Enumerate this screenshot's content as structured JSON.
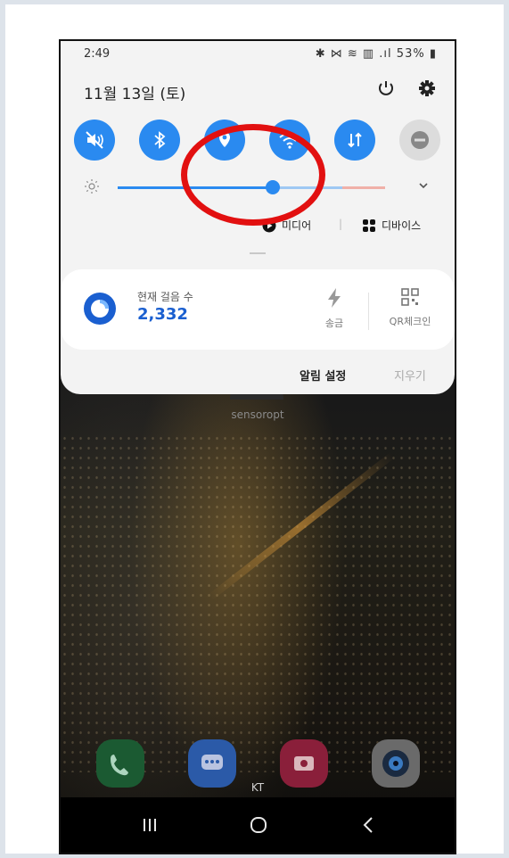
{
  "status_bar": {
    "time": "2:49",
    "icons": "✱ ⋈ ≋ ▥ .ıl",
    "battery": "53%"
  },
  "shade": {
    "date": "11월 13일 (토)",
    "power_icon": "power-icon",
    "settings_icon": "gear-icon",
    "quick_tiles": [
      {
        "name": "mute-icon",
        "state": "on"
      },
      {
        "name": "bluetooth-icon",
        "state": "on"
      },
      {
        "name": "location-icon",
        "state": "on"
      },
      {
        "name": "wifi-icon",
        "state": "on"
      },
      {
        "name": "data-transfer-icon",
        "state": "on"
      },
      {
        "name": "do-not-disturb-icon",
        "state": "off"
      }
    ],
    "brightness_level": 0.58,
    "media_label": "미디어",
    "devices_label": "디바이스"
  },
  "notification_card": {
    "steps_label": "현재 걸음 수",
    "steps_value": "2,332",
    "send_label": "송금",
    "qr_label": "QR체크인"
  },
  "footer": {
    "notification_settings": "알림 설정",
    "clear": "지우기"
  },
  "home": {
    "profile_label": "sensoropt",
    "carrier": "KT"
  },
  "colors": {
    "accent": "#2a8af0",
    "annotation": "#e21010",
    "step_value": "#1a5fd0"
  }
}
